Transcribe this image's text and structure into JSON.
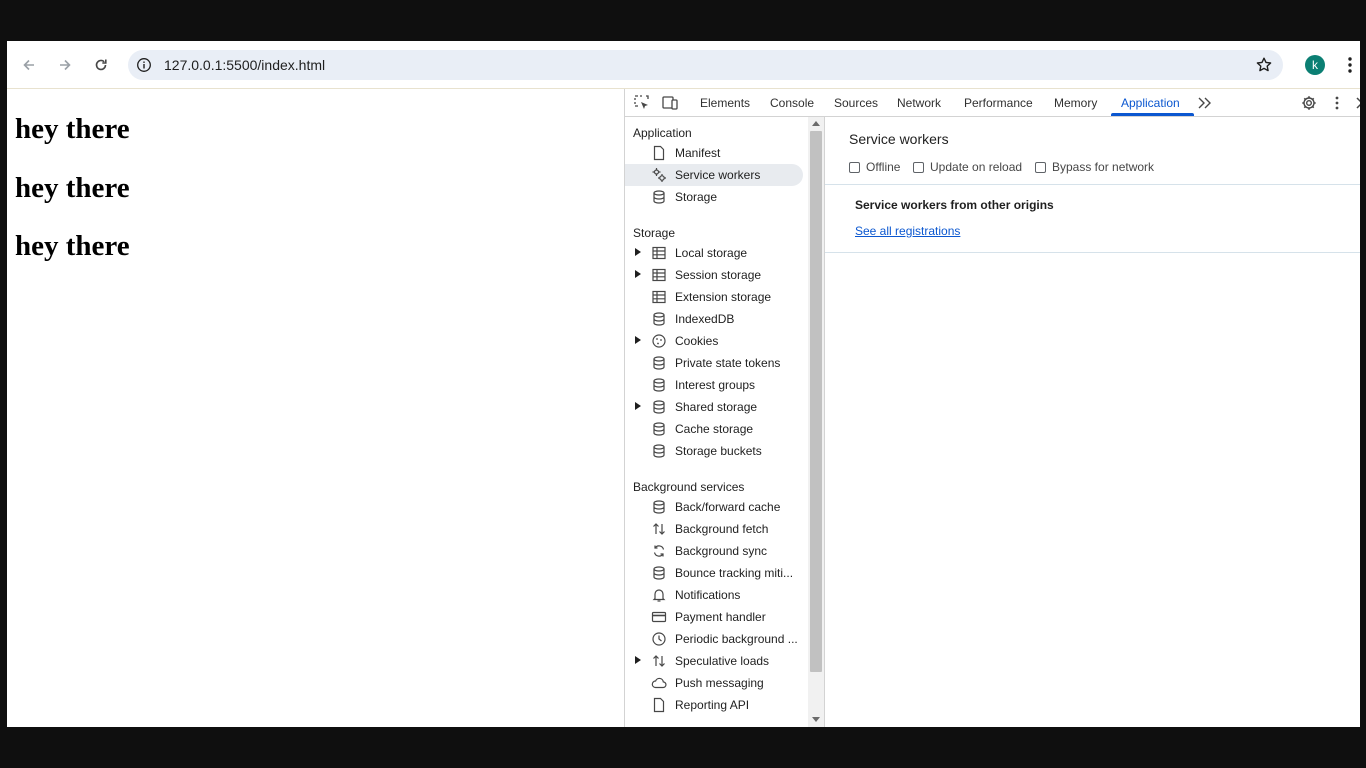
{
  "browser": {
    "url": "127.0.0.1:5500/index.html",
    "profile_initial": "k"
  },
  "page": {
    "headings": [
      "hey there",
      "hey there",
      "hey there"
    ]
  },
  "devtools": {
    "tabs": [
      "Elements",
      "Console",
      "Sources",
      "Network",
      "Performance",
      "Memory",
      "Application"
    ],
    "active_tab": "Application",
    "sidebar": {
      "application_title": "Application",
      "application_items": [
        "Manifest",
        "Service workers",
        "Storage"
      ],
      "storage_title": "Storage",
      "storage_items": [
        "Local storage",
        "Session storage",
        "Extension storage",
        "IndexedDB",
        "Cookies",
        "Private state tokens",
        "Interest groups",
        "Shared storage",
        "Cache storage",
        "Storage buckets"
      ],
      "background_title": "Background services",
      "background_items": [
        "Back/forward cache",
        "Background fetch",
        "Background sync",
        "Bounce tracking miti...",
        "Notifications",
        "Payment handler",
        "Periodic background ...",
        "Speculative loads",
        "Push messaging",
        "Reporting API"
      ]
    },
    "panel": {
      "title": "Service workers",
      "checkboxes": [
        "Offline",
        "Update on reload",
        "Bypass for network"
      ],
      "other_origins_title": "Service workers from other origins",
      "see_all_link": "See all registrations"
    }
  }
}
